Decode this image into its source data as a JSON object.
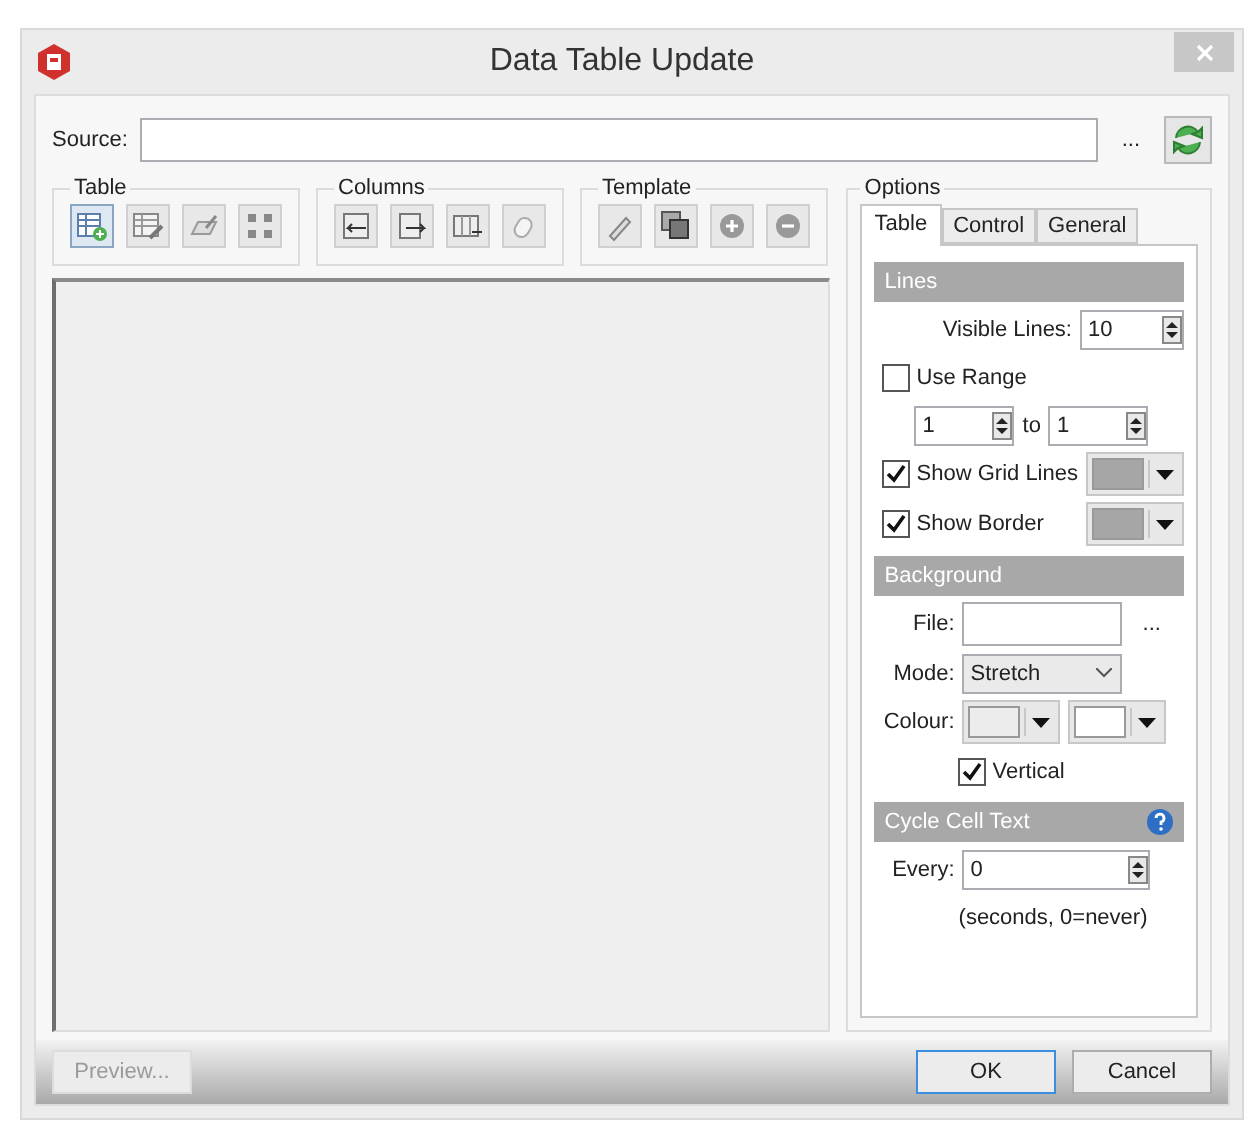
{
  "window": {
    "title": "Data Table Update"
  },
  "source": {
    "label": "Source:",
    "browse": "..."
  },
  "toolbar_groups": [
    {
      "title": "Table",
      "tools": [
        {
          "kind": "table-add",
          "selected": true
        },
        {
          "kind": "table-edit",
          "selected": false
        },
        {
          "kind": "pencil",
          "selected": false
        },
        {
          "kind": "grid",
          "selected": false
        }
      ]
    },
    {
      "title": "Columns",
      "tools": [
        {
          "kind": "col-left",
          "selected": false
        },
        {
          "kind": "col-right",
          "selected": false
        },
        {
          "kind": "col-insert",
          "selected": false
        },
        {
          "kind": "mouse",
          "selected": false
        }
      ]
    },
    {
      "title": "Template",
      "tools": [
        {
          "kind": "pen",
          "selected": false
        },
        {
          "kind": "copy",
          "selected": false
        },
        {
          "kind": "plus",
          "selected": false
        },
        {
          "kind": "minus",
          "selected": false
        }
      ]
    }
  ],
  "options": {
    "title": "Options",
    "tabs": [
      {
        "label": "Table",
        "selected": true
      },
      {
        "label": "Control",
        "selected": false
      },
      {
        "label": "General",
        "selected": false
      }
    ],
    "sections": [
      {
        "title": "Lines",
        "help": false,
        "rows": [
          {
            "kind": "spin",
            "label": "Visible Lines:",
            "value": "10"
          },
          {
            "kind": "check",
            "label": "Use Range",
            "checked": false
          },
          {
            "kind": "range",
            "from": "1",
            "to_label": "to",
            "to": "1"
          },
          {
            "kind": "check",
            "label": "Show Grid Lines",
            "checked": true,
            "color": "#a6a6a6"
          },
          {
            "kind": "check",
            "label": "Show Border",
            "checked": true,
            "color": "#a6a6a6"
          }
        ]
      },
      {
        "title": "Background",
        "help": false,
        "rows": [
          {
            "kind": "file",
            "label": "File:",
            "browse": "..."
          },
          {
            "kind": "select",
            "label": "Mode:",
            "value": "Stretch"
          },
          {
            "kind": "colours",
            "label": "Colour:",
            "swatches": [
              {
                "color": "#ececec"
              },
              {
                "color": "#ffffff"
              }
            ]
          },
          {
            "kind": "check",
            "label": "Vertical",
            "checked": true
          }
        ]
      },
      {
        "title": "Cycle Cell Text",
        "help": true,
        "rows": [
          {
            "kind": "counter",
            "label": "Every:",
            "value": "0"
          },
          {
            "kind": "note",
            "text": "(seconds, 0=never)"
          }
        ]
      }
    ]
  },
  "footer": {
    "preview": {
      "label": "Preview...",
      "disabled": true
    },
    "buttons": [
      {
        "label": "OK",
        "default": true
      },
      {
        "label": "Cancel",
        "default": false
      }
    ]
  }
}
